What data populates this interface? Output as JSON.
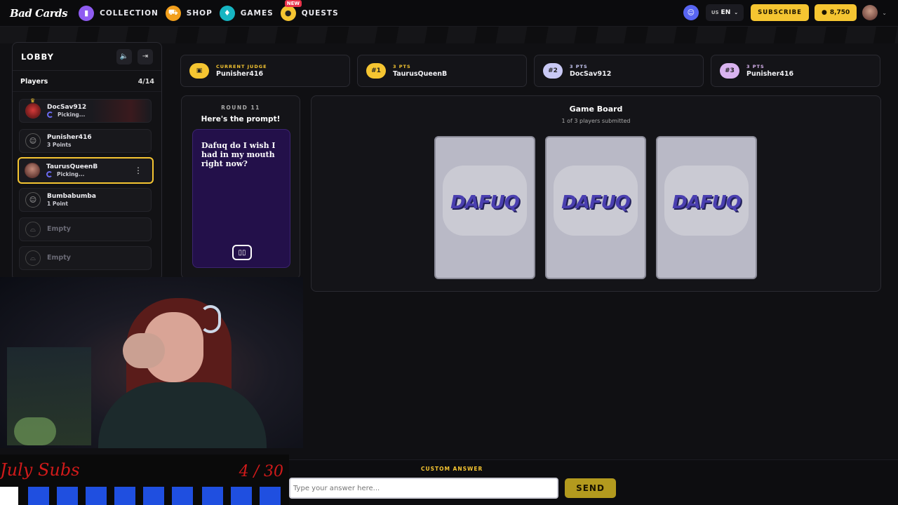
{
  "nav": {
    "logo": "Bad Cards",
    "items": [
      {
        "label": "COLLECTION",
        "icon": "cards-icon",
        "color": "#8f5cf2"
      },
      {
        "label": "SHOP",
        "icon": "cart-icon",
        "color": "#f29f1c"
      },
      {
        "label": "GAMES",
        "icon": "games-icon",
        "color": "#16b5c2"
      },
      {
        "label": "QUESTS",
        "icon": "quests-icon",
        "color": "#f5c531",
        "badge": "NEW"
      }
    ],
    "lang_region": "US",
    "lang": "EN",
    "subscribe": "SUBSCRIBE",
    "coins": "8,750"
  },
  "lobby": {
    "title": "LOBBY",
    "players_label": "Players",
    "players_count": "4/14",
    "players": [
      {
        "name": "DocSav912",
        "status": "Picking..."
      },
      {
        "name": "Punisher416",
        "status": "3 Points"
      },
      {
        "name": "TaurusQueenB",
        "status": "Picking..."
      },
      {
        "name": "Bumbabumba",
        "status": "1 Point"
      },
      {
        "name": "Empty",
        "status": ""
      },
      {
        "name": "Empty",
        "status": ""
      }
    ]
  },
  "scores": [
    {
      "badge": "",
      "label": "CURRENT JUDGE",
      "name": "Punisher416",
      "color": "#f5c531"
    },
    {
      "badge": "#1",
      "label": "3 PTS",
      "name": "TaurusQueenB",
      "color": "#f5c531"
    },
    {
      "badge": "#2",
      "label": "3 PTS",
      "name": "DocSav912",
      "color": "#c9c9f5"
    },
    {
      "badge": "#3",
      "label": "3 PTS",
      "name": "Punisher416",
      "color": "#d9b3f0"
    }
  ],
  "prompt": {
    "round": "ROUND 11",
    "heading": "Here's the prompt!",
    "card_text": "Dafuq do I wish I had in my mouth right now?"
  },
  "board": {
    "title": "Game Board",
    "subtitle": "1 of 3 players submitted",
    "cards": [
      "DAFUQ",
      "DAFUQ",
      "DAFUQ"
    ]
  },
  "overlay": {
    "sub_goal_title": "July Subs",
    "sub_goal_count": "4 / 30",
    "sub_goal_progress": 0.1333
  },
  "answer": {
    "label": "CUSTOM ANSWER",
    "placeholder": "Type your answer here...",
    "send": "SEND"
  }
}
